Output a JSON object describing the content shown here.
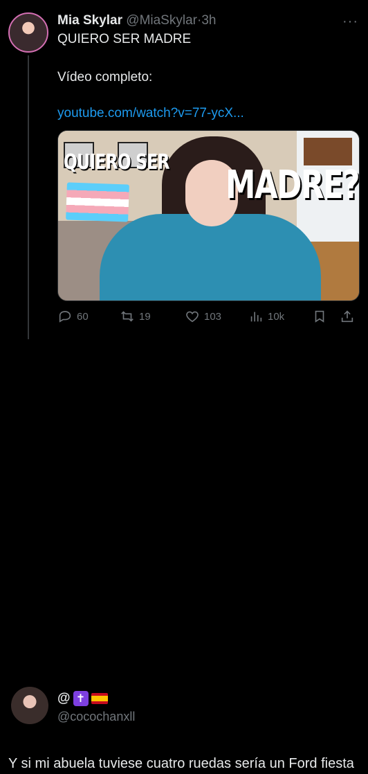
{
  "tweet": {
    "author_name": "Mia Skylar",
    "author_handle": "@MiaSkylar",
    "separator": "·",
    "time": "3h",
    "line1": "QUIERO SER MADRE",
    "line2": "Vídeo completo:",
    "link": "youtube.com/watch?v=77-ycX...",
    "media": {
      "title_small": "QUIERO SER",
      "title_large": "MADRE?"
    },
    "actions": {
      "replies": "60",
      "retweets": "19",
      "likes": "103",
      "views": "10k"
    }
  },
  "reply": {
    "name_prefix": "@",
    "badge_cross": "✝",
    "handle": "@cocochanxll",
    "text": "Y si mi abuela tuviese cuatro ruedas sería un Ford fiesta"
  },
  "colors": {
    "background": "#000000",
    "text": "#e7e9ea",
    "muted": "#71767b",
    "link": "#1d9bf0"
  },
  "icons": [
    "more-icon",
    "reply-icon",
    "retweet-icon",
    "like-icon",
    "views-icon",
    "bookmark-icon",
    "share-icon"
  ]
}
